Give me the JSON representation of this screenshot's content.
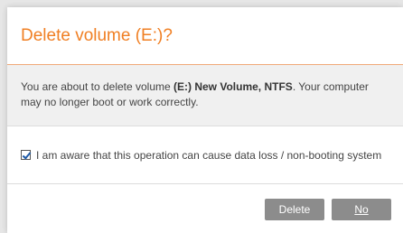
{
  "dialog": {
    "title": "Delete volume (E:)?",
    "message_prefix": "You are about to delete volume ",
    "message_volume": "(E:) New Volume, NTFS",
    "message_suffix": ". Your computer may no longer boot or work correctly.",
    "checkbox_label": "I am aware that this operation can cause data loss / non-booting system",
    "checkbox_checked": true,
    "delete_label": "Delete",
    "no_label": "No",
    "accent_color": "#f07f23"
  }
}
